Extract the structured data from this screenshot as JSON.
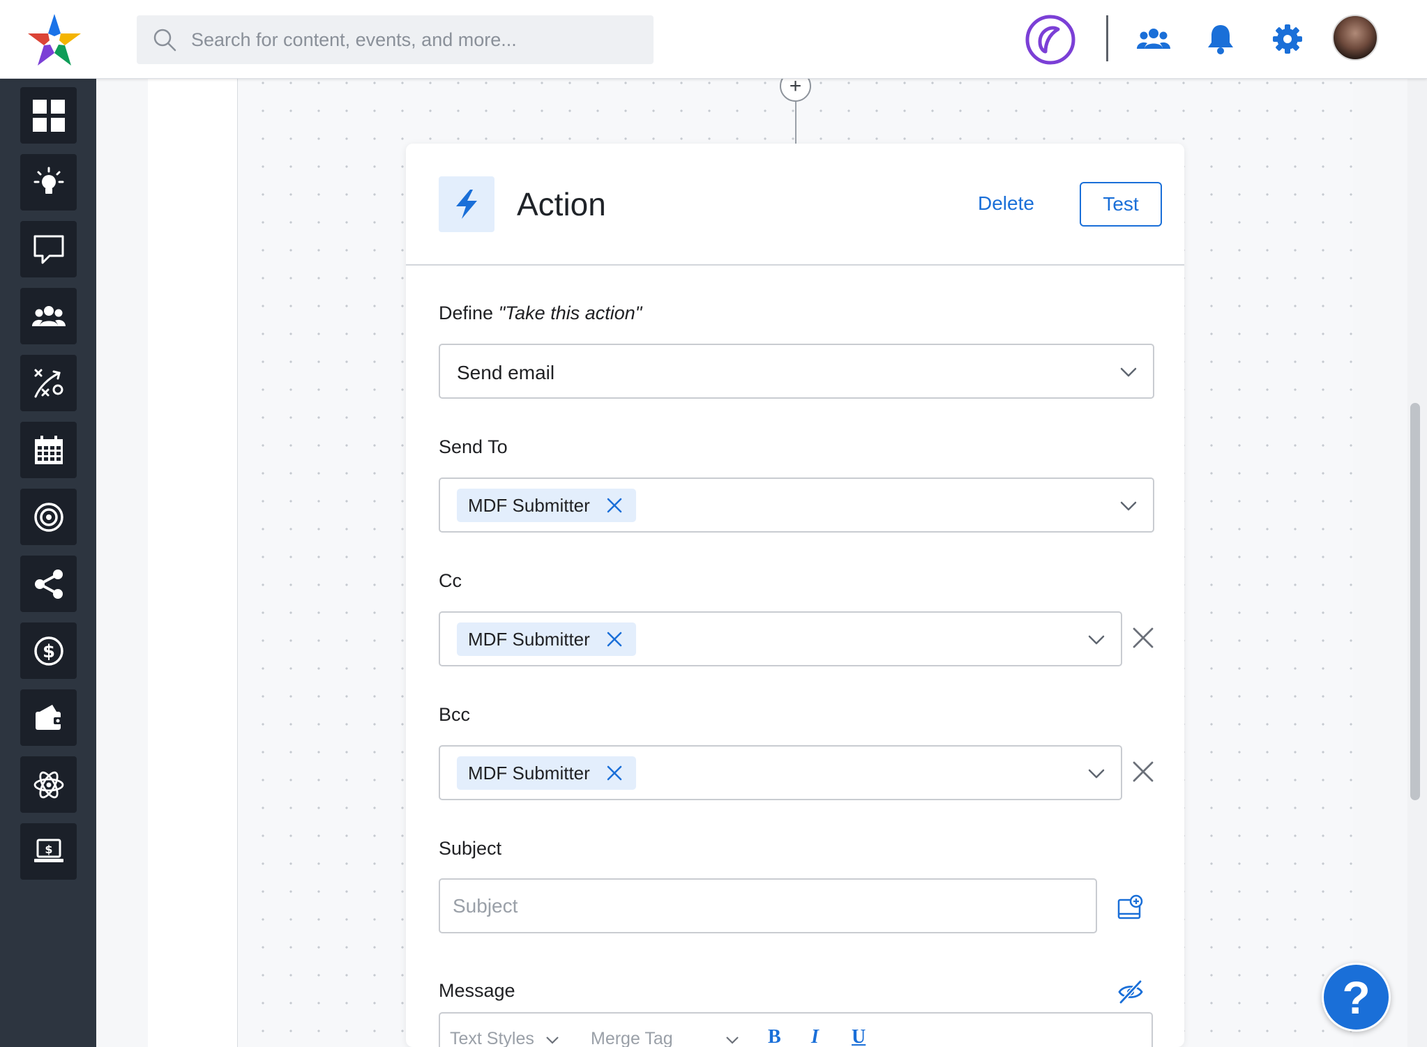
{
  "search": {
    "placeholder": "Search for content, events, and more..."
  },
  "header": {
    "icons": [
      "team-icon",
      "bell-icon",
      "gear-icon",
      "user-avatar"
    ],
    "accent_color": "#1a6fd8",
    "brand_color": "#7b3fd6"
  },
  "sidebar": {
    "items": [
      {
        "name": "dashboard",
        "icon": "grid-icon"
      },
      {
        "name": "ideas",
        "icon": "lightbulb-icon"
      },
      {
        "name": "messages",
        "icon": "chat-icon"
      },
      {
        "name": "partners",
        "icon": "users-icon"
      },
      {
        "name": "strategy",
        "icon": "play-strategy-icon"
      },
      {
        "name": "calendar",
        "icon": "calendar-icon"
      },
      {
        "name": "goals",
        "icon": "target-icon"
      },
      {
        "name": "share",
        "icon": "share-icon"
      },
      {
        "name": "funds",
        "icon": "dollar-circle-icon"
      },
      {
        "name": "wallet",
        "icon": "wallet-icon"
      },
      {
        "name": "integrations",
        "icon": "atom-icon"
      },
      {
        "name": "billing",
        "icon": "laptop-dollar-icon"
      }
    ]
  },
  "canvas": {
    "add_node_label": "+"
  },
  "card": {
    "title": "Action",
    "delete_label": "Delete",
    "test_label": "Test",
    "define_label": "Define ",
    "define_quote": "\"Take this action\"",
    "action_select": {
      "value": "Send email"
    },
    "send_to": {
      "label": "Send To",
      "chips": [
        "MDF Submitter"
      ]
    },
    "cc": {
      "label": "Cc",
      "chips": [
        "MDF Submitter"
      ]
    },
    "bcc": {
      "label": "Bcc",
      "chips": [
        "MDF Submitter"
      ]
    },
    "subject": {
      "label": "Subject",
      "placeholder": "Subject",
      "value": ""
    },
    "message": {
      "label": "Message",
      "toolbar": {
        "text_styles": "Text Styles",
        "merge_tag": "Merge Tag",
        "bold": "B",
        "italic": "I",
        "underline": "U"
      }
    }
  },
  "help": {
    "label": "?"
  }
}
